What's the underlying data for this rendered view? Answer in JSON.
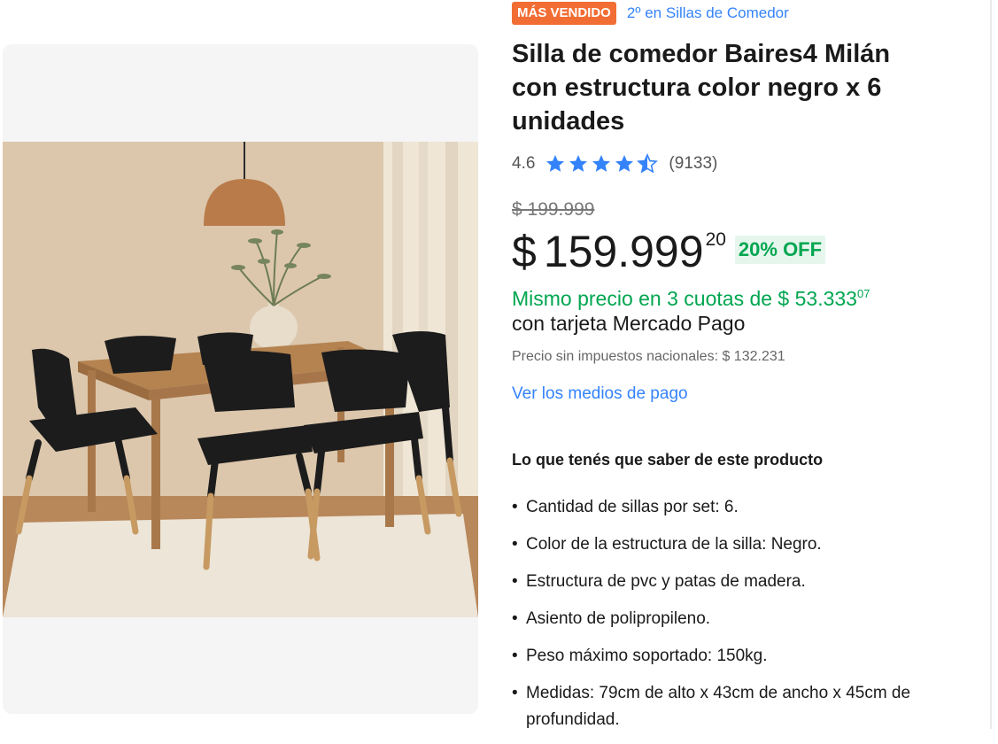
{
  "product": {
    "badge": "MÁS VENDIDO",
    "rank": "2º en Sillas de Comedor",
    "title": "Silla de comedor Baires4 Milán con estructura color negro x 6 unidades",
    "rating": {
      "value": "4.6",
      "stars": 4.5,
      "reviews": "(9133)"
    },
    "price": {
      "original": "$ 199.999",
      "currency": "$",
      "amount": "159.999",
      "cents": "20",
      "discount": "20% OFF"
    },
    "installments": {
      "text": "Mismo precio en 3 cuotas de $ 53.333",
      "cents": "07",
      "card": "con tarjeta Mercado Pago"
    },
    "tax_note": "Precio sin impuestos nacionales: $ 132.231",
    "payment_link": "Ver los medios de pago",
    "features_title": "Lo que tenés que saber de este producto",
    "features": [
      "Cantidad de sillas por set: 6.",
      "Color de la estructura de la silla: Negro.",
      "Estructura de pvc y patas de madera.",
      "Asiento de polipropileno.",
      "Peso máximo soportado: 150kg.",
      "Medidas: 79cm de alto x 43cm de ancho x 45cm de profundidad."
    ],
    "bullet": "•"
  },
  "colors": {
    "badge_bg": "#f26d34",
    "link": "#3483fa",
    "green": "#00a650",
    "discount_bg": "#e6f6ed",
    "star": "#3483fa"
  },
  "icons": [
    "star-icon",
    "half-star-icon"
  ]
}
